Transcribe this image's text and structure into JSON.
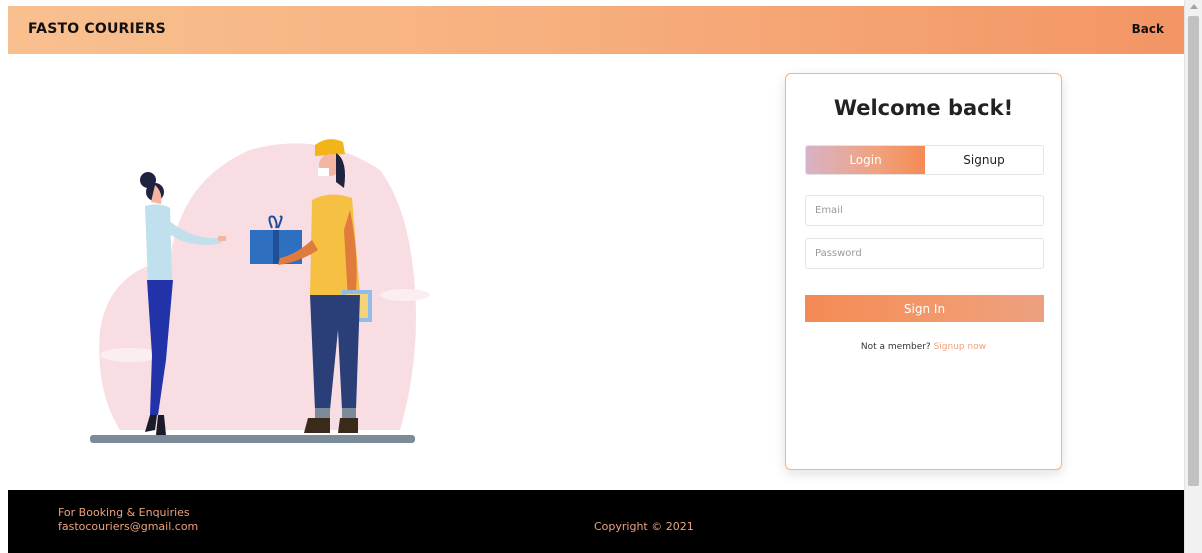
{
  "navbar": {
    "brand": "FASTO COURIERS",
    "back_label": "Back"
  },
  "illustration": {
    "icon": "courier-delivery-illustration"
  },
  "login_card": {
    "title": "Welcome back!",
    "tabs": [
      {
        "label": "Login",
        "active": true
      },
      {
        "label": "Signup",
        "active": false
      }
    ],
    "email": {
      "value": "",
      "placeholder": "Email"
    },
    "password": {
      "value": "",
      "placeholder": "Password"
    },
    "signin_label": "Sign In",
    "member_prompt": "Not a member?",
    "signup_link": "Signup now"
  },
  "footer": {
    "booking_label": "For Booking & Enquiries",
    "email": "fastocouriers@gmail.com",
    "copyright": "Copyright © 2021"
  },
  "colors": {
    "accent": "#f48a55",
    "link": "#f0a27d",
    "footer_bg": "#000000"
  }
}
